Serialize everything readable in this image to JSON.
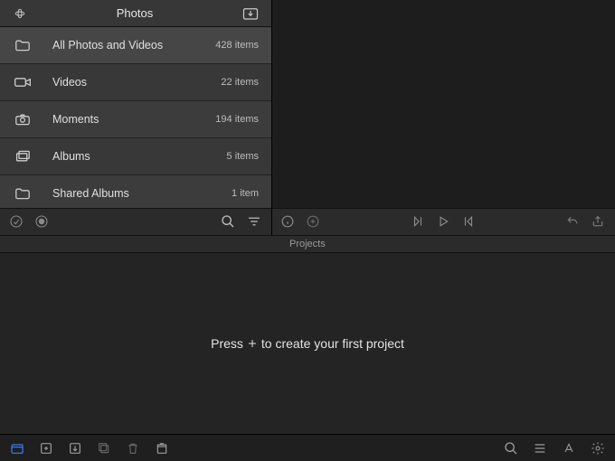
{
  "sidebar": {
    "title": "Photos",
    "items": [
      {
        "icon": "folder-icon",
        "label": "All Photos and Videos",
        "count": "428 items"
      },
      {
        "icon": "video-icon",
        "label": "Videos",
        "count": "22 items"
      },
      {
        "icon": "camera-icon",
        "label": "Moments",
        "count": "194 items"
      },
      {
        "icon": "albums-icon",
        "label": "Albums",
        "count": "5 items"
      },
      {
        "icon": "folder-icon",
        "label": "Shared Albums",
        "count": "1 item"
      }
    ]
  },
  "projects": {
    "header": "Projects",
    "empty_hint_before": "Press",
    "empty_hint_after": "to create your first project"
  }
}
